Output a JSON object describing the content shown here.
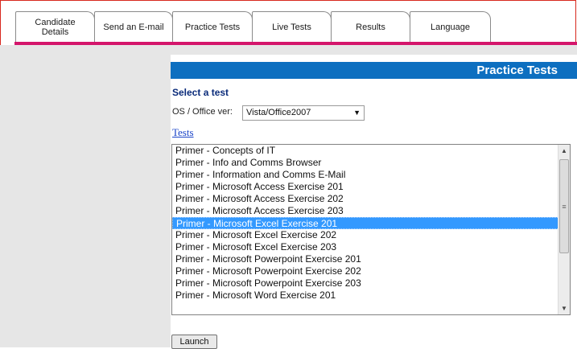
{
  "tabs": [
    {
      "label": "Candidate\nDetails",
      "active": false
    },
    {
      "label": "Send an E-mail",
      "active": false
    },
    {
      "label": "Practice Tests",
      "active": true
    },
    {
      "label": "Live Tests",
      "active": false
    },
    {
      "label": "Results",
      "active": false
    },
    {
      "label": "Language",
      "active": false
    }
  ],
  "header": {
    "title": "Practice Tests"
  },
  "select_test": {
    "heading": "Select a test"
  },
  "os_office": {
    "label": "OS / Office ver:",
    "selected": "Vista/Office2007"
  },
  "tests_link": "Tests",
  "tests_list": {
    "items": [
      "Primer - Concepts of IT",
      "Primer - Info and Comms Browser",
      "Primer - Information and Comms E-Mail",
      "Primer - Microsoft Access Exercise 201",
      "Primer - Microsoft Access Exercise 202",
      "Primer - Microsoft Access Exercise 203",
      "Primer - Microsoft Excel Exercise 201",
      "Primer - Microsoft Excel Exercise 202",
      "Primer - Microsoft Excel Exercise 203",
      "Primer - Microsoft Powerpoint Exercise 201",
      "Primer - Microsoft Powerpoint Exercise 202",
      "Primer - Microsoft Powerpoint Exercise 203",
      "Primer - Microsoft Word Exercise 201"
    ],
    "selected_index": 6
  },
  "launch_label": "Launch",
  "colors": {
    "accent_pink": "#d4156b",
    "header_blue": "#0d6fc0",
    "selection_blue": "#3399ff",
    "frame_red": "#d8281e"
  },
  "icons": {
    "dropdown": "chevron-down-icon",
    "scroll_up": "arrow-up-icon",
    "scroll_down": "arrow-down-icon",
    "scroll_grip": "grip-icon"
  }
}
